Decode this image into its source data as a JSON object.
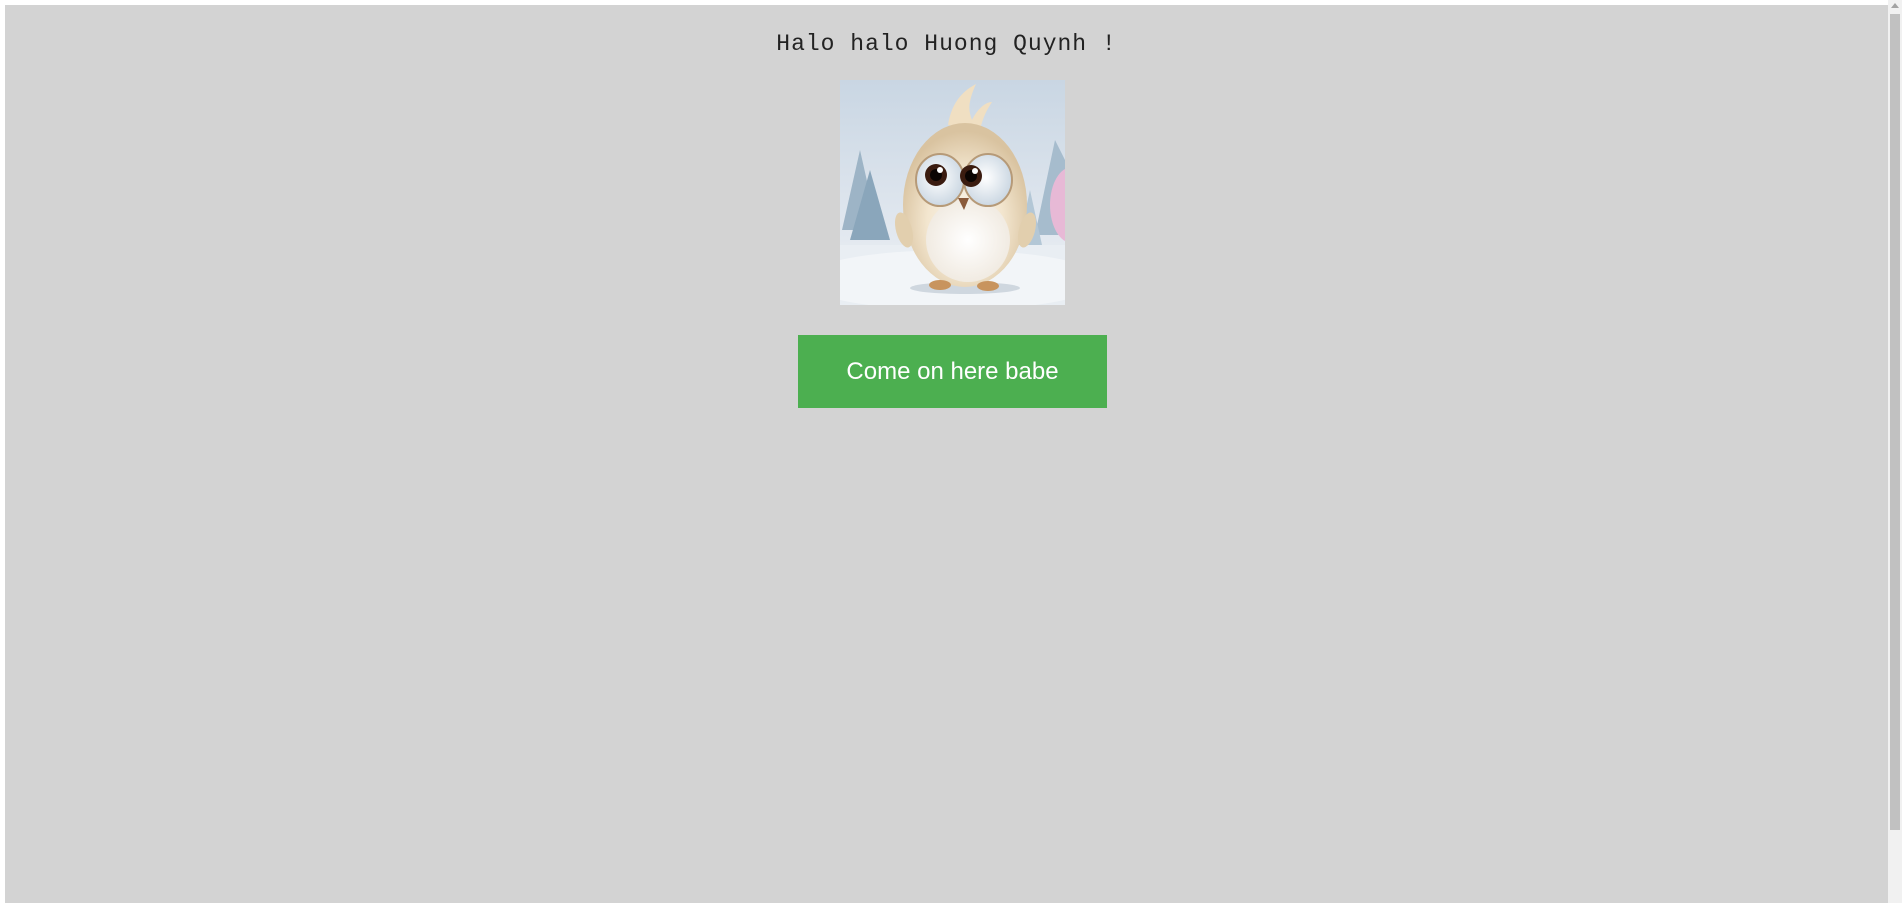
{
  "page": {
    "background": "#d3d3d3",
    "greeting": "Halo halo Huong Quynh !"
  },
  "image": {
    "alt": "fluffy cream-colored baby bird with big eyes in snowy forest",
    "icon": "baby-bird-illustration"
  },
  "button": {
    "label": "Come on here babe",
    "color": "#4caf50",
    "text_color": "#ffffff"
  },
  "scrollbar": {
    "up_icon": "triangle-up-icon"
  }
}
